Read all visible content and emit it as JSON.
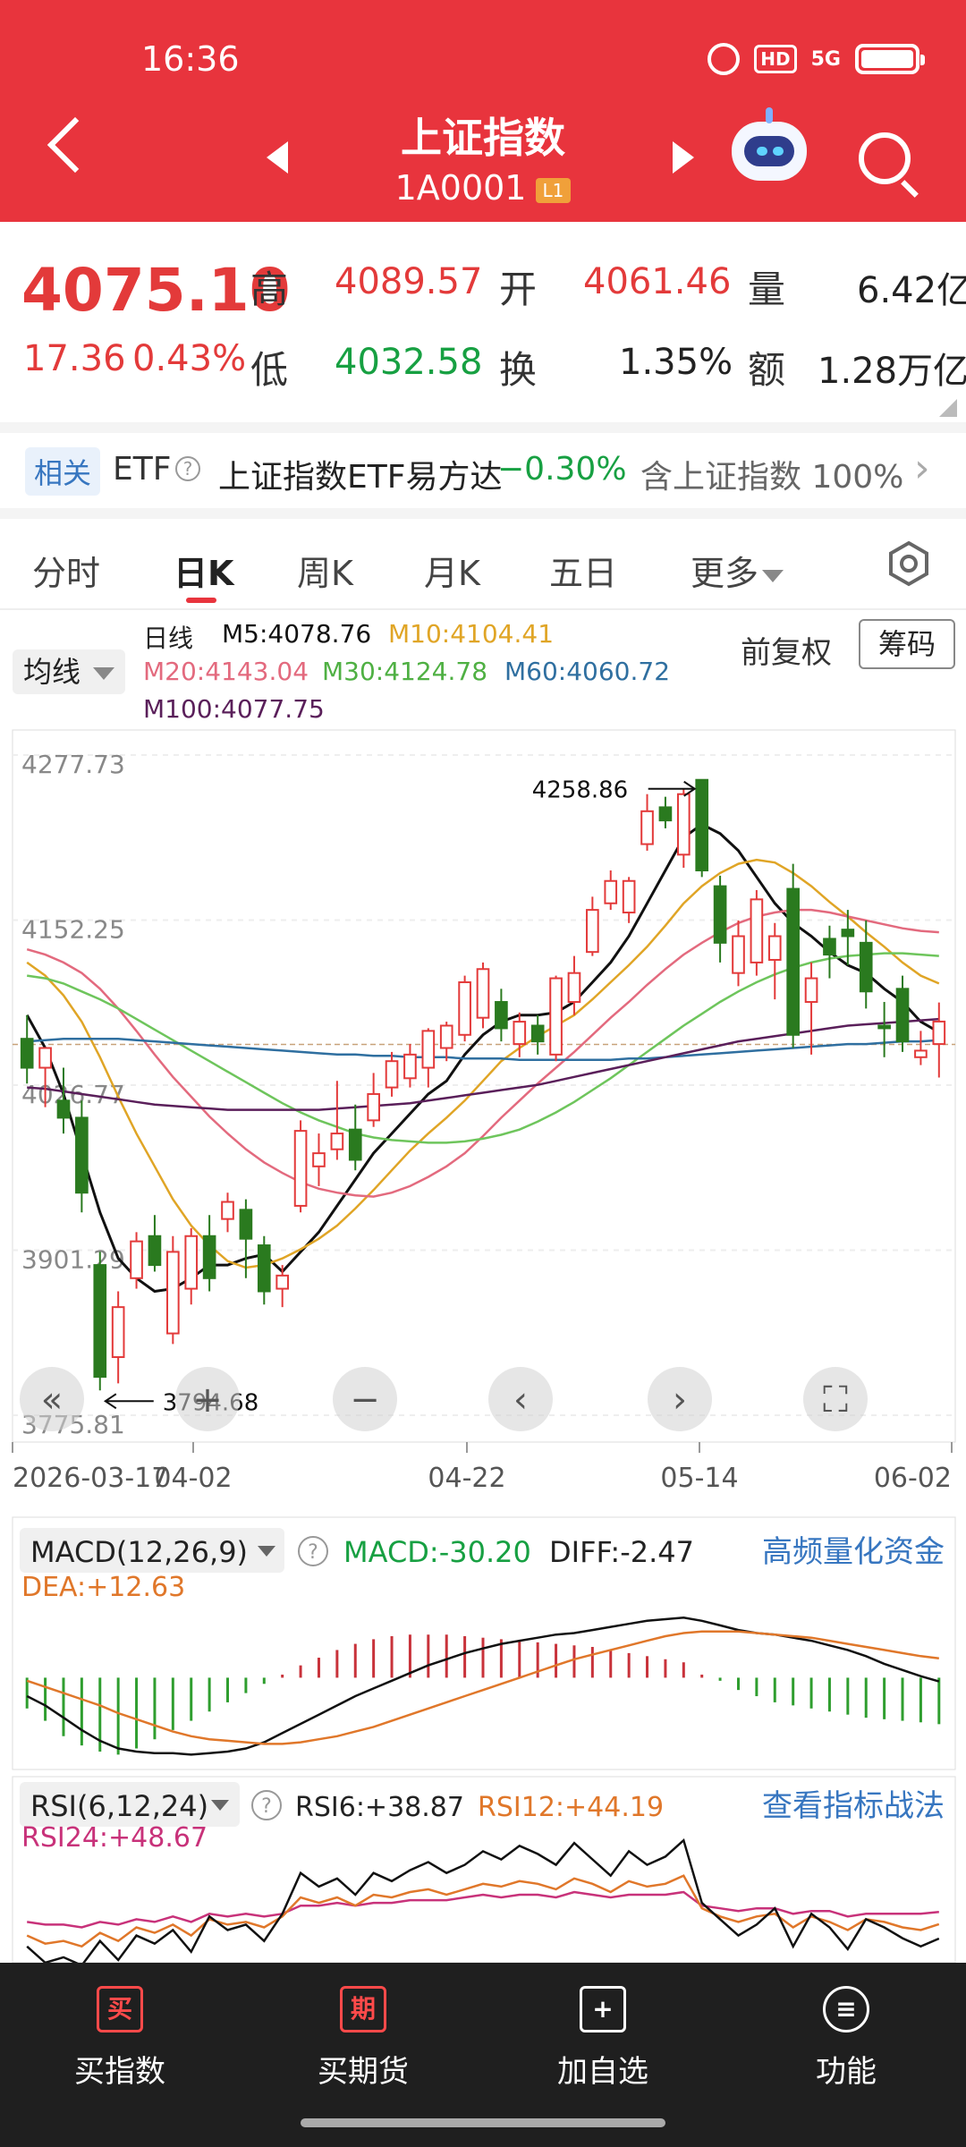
{
  "status": {
    "time": "16:36",
    "hd": "HD",
    "net": "5G"
  },
  "header": {
    "title": "上证指数",
    "code": "1A0001",
    "level": "L1"
  },
  "quote": {
    "price": "4075.10",
    "change": "17.36",
    "change_pct": "0.43%",
    "high_label": "高",
    "high": "4089.57",
    "open_label": "开",
    "open": "4061.46",
    "volume_label": "量",
    "volume": "6.42亿",
    "low_label": "低",
    "low": "4032.58",
    "turnover_label": "换",
    "turnover": "1.35%",
    "amount_label": "额",
    "amount": "1.28万亿"
  },
  "etf": {
    "tag": "相关",
    "prefix": "ETF",
    "help": "?",
    "name": "上证指数ETF易方达",
    "change": "−0.30%",
    "holding": "含上证指数 100%",
    "arrow": "›"
  },
  "tabs": [
    "分时",
    "日K",
    "周K",
    "月K",
    "五日",
    "更多"
  ],
  "ma": {
    "button": "均线",
    "period": "日线",
    "m5": "M5:4078.76",
    "m10": "M10:4104.41",
    "m20": "M20:4143.04",
    "m30": "M30:4124.78",
    "m60": "M60:4060.72",
    "m100": "M100:4077.75",
    "adjust": "前复权",
    "chip": "筹码"
  },
  "colors": {
    "up": "#e33a3a",
    "down": "#2a7a1f",
    "m5": "#111111",
    "m10": "#e0a526",
    "m20": "#e36a7e",
    "m30": "#6ec55c",
    "m60": "#2f6fa0",
    "m100": "#5a1f5a"
  },
  "chart_data": [
    {
      "type": "candlestick",
      "ylim": [
        3775.81,
        4277.73
      ],
      "y_ticks": [
        "4277.73",
        "4152.25",
        "4026.77",
        "3901.29",
        "3775.81"
      ],
      "x_ticks": [
        "2026-03-17",
        "04-02",
        "04-22",
        "05-14",
        "06-02"
      ],
      "max_label": "4258.86",
      "min_label": "3794.68",
      "reference_line": 4057.74,
      "candles": [
        {
          "o": 4062,
          "h": 4080,
          "l": 4028,
          "c": 4040
        },
        {
          "o": 4040,
          "h": 4055,
          "l": 4010,
          "c": 4055
        },
        {
          "o": 4015,
          "h": 4040,
          "l": 3990,
          "c": 4002
        },
        {
          "o": 4002,
          "h": 4015,
          "l": 3930,
          "c": 3945
        },
        {
          "o": 3890,
          "h": 3900,
          "l": 3794.68,
          "c": 3805
        },
        {
          "o": 3820,
          "h": 3870,
          "l": 3800,
          "c": 3858
        },
        {
          "o": 3880,
          "h": 3915,
          "l": 3872,
          "c": 3908
        },
        {
          "o": 3912,
          "h": 3928,
          "l": 3885,
          "c": 3890
        },
        {
          "o": 3838,
          "h": 3912,
          "l": 3830,
          "c": 3900
        },
        {
          "o": 3872,
          "h": 3918,
          "l": 3860,
          "c": 3912
        },
        {
          "o": 3912,
          "h": 3928,
          "l": 3870,
          "c": 3880
        },
        {
          "o": 3925,
          "h": 3945,
          "l": 3915,
          "c": 3938
        },
        {
          "o": 3932,
          "h": 3940,
          "l": 3880,
          "c": 3910
        },
        {
          "o": 3905,
          "h": 3912,
          "l": 3860,
          "c": 3870
        },
        {
          "o": 3872,
          "h": 3890,
          "l": 3858,
          "c": 3882
        },
        {
          "o": 3935,
          "h": 4000,
          "l": 3930,
          "c": 3992
        },
        {
          "o": 3965,
          "h": 3990,
          "l": 3950,
          "c": 3975
        },
        {
          "o": 3978,
          "h": 4030,
          "l": 3970,
          "c": 3990
        },
        {
          "o": 3993,
          "h": 4012,
          "l": 3962,
          "c": 3970
        },
        {
          "o": 4000,
          "h": 4036,
          "l": 3995,
          "c": 4020
        },
        {
          "o": 4025,
          "h": 4052,
          "l": 4018,
          "c": 4045
        },
        {
          "o": 4032,
          "h": 4058,
          "l": 4025,
          "c": 4050
        },
        {
          "o": 4040,
          "h": 4070,
          "l": 4025,
          "c": 4068
        },
        {
          "o": 4055,
          "h": 4075,
          "l": 4045,
          "c": 4072
        },
        {
          "o": 4065,
          "h": 4110,
          "l": 4060,
          "c": 4105
        },
        {
          "o": 4078,
          "h": 4120,
          "l": 4070,
          "c": 4115
        },
        {
          "o": 4090,
          "h": 4100,
          "l": 4060,
          "c": 4070
        },
        {
          "o": 4058,
          "h": 4082,
          "l": 4048,
          "c": 4075
        },
        {
          "o": 4072,
          "h": 4080,
          "l": 4050,
          "c": 4060
        },
        {
          "o": 4050,
          "h": 4110,
          "l": 4045,
          "c": 4108
        },
        {
          "o": 4090,
          "h": 4125,
          "l": 4080,
          "c": 4112
        },
        {
          "o": 4128,
          "h": 4170,
          "l": 4125,
          "c": 4160
        },
        {
          "o": 4165,
          "h": 4190,
          "l": 4160,
          "c": 4182
        },
        {
          "o": 4158,
          "h": 4185,
          "l": 4150,
          "c": 4182
        },
        {
          "o": 4210,
          "h": 4248,
          "l": 4205,
          "c": 4235
        },
        {
          "o": 4238,
          "h": 4246,
          "l": 4222,
          "c": 4228
        },
        {
          "o": 4202,
          "h": 4252,
          "l": 4192,
          "c": 4248
        },
        {
          "o": 4258.86,
          "h": 4258.86,
          "l": 4185,
          "c": 4190
        },
        {
          "o": 4178,
          "h": 4186,
          "l": 4120,
          "c": 4135
        },
        {
          "o": 4112,
          "h": 4152,
          "l": 4102,
          "c": 4140
        },
        {
          "o": 4120,
          "h": 4175,
          "l": 4110,
          "c": 4168
        },
        {
          "o": 4122,
          "h": 4150,
          "l": 4092,
          "c": 4140
        },
        {
          "o": 4176,
          "h": 4195,
          "l": 4055,
          "c": 4065
        },
        {
          "o": 4090,
          "h": 4120,
          "l": 4050,
          "c": 4108
        },
        {
          "o": 4138,
          "h": 4148,
          "l": 4108,
          "c": 4126
        },
        {
          "o": 4145,
          "h": 4160,
          "l": 4118,
          "c": 4140
        },
        {
          "o": 4135,
          "h": 4152,
          "l": 4085,
          "c": 4098
        },
        {
          "o": 4072,
          "h": 4090,
          "l": 4048,
          "c": 4070
        },
        {
          "o": 4100,
          "h": 4110,
          "l": 4052,
          "c": 4060
        },
        {
          "o": 4048,
          "h": 4068,
          "l": 4042,
          "c": 4053
        },
        {
          "o": 4058,
          "h": 4089.57,
          "l": 4032.58,
          "c": 4075.1
        }
      ],
      "ma_lines": [
        {
          "name": "M5",
          "values": [
            4080,
            4055,
            4020,
            3975,
            3930,
            3895,
            3880,
            3870,
            3872,
            3880,
            3890,
            3890,
            3895,
            3898,
            3885,
            3900,
            3915,
            3935,
            3955,
            3975,
            3990,
            4005,
            4020,
            4030,
            4050,
            4065,
            4075,
            4080,
            4080,
            4082,
            4090,
            4105,
            4120,
            4140,
            4165,
            4190,
            4215,
            4225,
            4218,
            4205,
            4185,
            4165,
            4150,
            4140,
            4128,
            4118,
            4112,
            4100,
            4090,
            4075,
            4067
          ]
        },
        {
          "name": "M10",
          "values": [
            4120,
            4110,
            4095,
            4075,
            4048,
            4018,
            3990,
            3965,
            3940,
            3920,
            3905,
            3893,
            3888,
            3890,
            3895,
            3902,
            3910,
            3920,
            3933,
            3947,
            3962,
            3977,
            3990,
            4002,
            4015,
            4030,
            4045,
            4055,
            4064,
            4072,
            4080,
            4092,
            4105,
            4118,
            4132,
            4148,
            4165,
            4178,
            4188,
            4195,
            4198,
            4196,
            4188,
            4178,
            4166,
            4155,
            4143,
            4132,
            4120,
            4110,
            4104
          ]
        },
        {
          "name": "M20",
          "values": [
            4130,
            4126,
            4120,
            4112,
            4100,
            4085,
            4068,
            4050,
            4033,
            4018,
            4003,
            3990,
            3978,
            3968,
            3960,
            3953,
            3948,
            3945,
            3943,
            3942,
            3945,
            3950,
            3957,
            3965,
            3975,
            3988,
            4002,
            4015,
            4028,
            4040,
            4052,
            4065,
            4078,
            4090,
            4103,
            4115,
            4126,
            4135,
            4143,
            4150,
            4155,
            4158,
            4160,
            4160,
            4158,
            4155,
            4152,
            4149,
            4146,
            4144,
            4143
          ]
        },
        {
          "name": "M30",
          "values": [
            4110,
            4108,
            4104,
            4098,
            4092,
            4085,
            4077,
            4069,
            4061,
            4053,
            4045,
            4037,
            4029,
            4021,
            4013,
            4006,
            4000,
            3995,
            3990,
            3987,
            3985,
            3984,
            3983,
            3983,
            3984,
            3986,
            3989,
            3993,
            3999,
            4006,
            4014,
            4023,
            4032,
            4042,
            4052,
            4062,
            4072,
            4081,
            4090,
            4098,
            4105,
            4111,
            4116,
            4120,
            4123,
            4125,
            4126,
            4127,
            4127,
            4126,
            4125
          ]
        },
        {
          "name": "M60",
          "values": [
            4060,
            4061,
            4062,
            4062,
            4062,
            4062,
            4061,
            4060,
            4059,
            4058,
            4057,
            4056,
            4055,
            4054,
            4053,
            4052,
            4051,
            4050,
            4050,
            4049,
            4049,
            4048,
            4048,
            4048,
            4047,
            4047,
            4047,
            4046,
            4046,
            4046,
            4046,
            4046,
            4046,
            4047,
            4047,
            4048,
            4049,
            4050,
            4051,
            4052,
            4053,
            4054,
            4055,
            4056,
            4057,
            4058,
            4058,
            4059,
            4060,
            4060,
            4061
          ]
        },
        {
          "name": "M100",
          "values": [
            4025,
            4024,
            4022,
            4020,
            4018,
            4016,
            4014,
            4012,
            4011,
            4010,
            4009,
            4008,
            4008,
            4008,
            4008,
            4008,
            4008,
            4009,
            4010,
            4011,
            4012,
            4013,
            4015,
            4017,
            4019,
            4021,
            4023,
            4025,
            4027,
            4030,
            4033,
            4036,
            4039,
            4042,
            4045,
            4048,
            4051,
            4054,
            4057,
            4060,
            4062,
            4064,
            4066,
            4068,
            4070,
            4072,
            4073,
            4074,
            4075,
            4076,
            4077
          ]
        }
      ]
    },
    {
      "type": "macd",
      "params": "MACD(12,26,9)",
      "macd_label": "MACD:-30.20",
      "diff_label": "DIFF:-2.47",
      "dea_label": "DEA:+12.63",
      "ylim": [
        -55,
        45
      ],
      "hist": [
        -20,
        -28,
        -38,
        -44,
        -48,
        -50,
        -46,
        -40,
        -34,
        -28,
        -22,
        -16,
        -10,
        -4,
        2,
        8,
        13,
        18,
        22,
        25,
        27,
        28,
        28,
        28,
        27,
        26,
        25,
        24,
        23,
        22,
        21,
        20,
        18,
        16,
        14,
        12,
        10,
        2,
        -2,
        -8,
        -12,
        -16,
        -18,
        -20,
        -22,
        -24,
        -26,
        -27,
        -28,
        -29,
        -30.2
      ],
      "diff": [
        -12,
        -18,
        -26,
        -34,
        -41,
        -46,
        -48,
        -49,
        -49,
        -50,
        -49,
        -48,
        -46,
        -42,
        -36,
        -30,
        -24,
        -18,
        -12,
        -7,
        -2,
        3,
        8,
        12,
        16,
        19,
        22,
        24,
        26,
        28,
        29,
        31,
        33,
        35,
        37,
        38,
        39,
        37,
        34,
        31,
        29,
        28,
        26,
        24,
        21,
        18,
        14,
        9,
        5,
        1,
        -2.47
      ],
      "dea": [
        -2,
        -6,
        -10,
        -14,
        -18,
        -23,
        -27,
        -31,
        -35,
        -38,
        -40,
        -41,
        -42,
        -43,
        -43,
        -42,
        -40,
        -38,
        -35,
        -32,
        -28,
        -24,
        -20,
        -16,
        -12,
        -8,
        -4,
        0,
        4,
        8,
        12,
        15,
        18,
        21,
        24,
        27,
        29,
        30,
        30,
        30,
        29,
        28,
        27,
        26,
        24,
        22,
        20,
        18,
        16,
        14,
        12.63
      ]
    },
    {
      "type": "rsi",
      "params": "RSI(6,12,24)",
      "rsi6_label": "RSI6:+38.87",
      "rsi12_label": "RSI12:+44.19",
      "rsi24_label": "RSI24:+48.67",
      "ylim": [
        30,
        80
      ],
      "rsi6": [
        36,
        30,
        32,
        29,
        38,
        31,
        40,
        37,
        42,
        34,
        47,
        42,
        44,
        38,
        48,
        63,
        58,
        61,
        55,
        63,
        60,
        64,
        67,
        63,
        66,
        71,
        68,
        73,
        70,
        66,
        74,
        68,
        62,
        71,
        66,
        69,
        75,
        52,
        46,
        40,
        44,
        50,
        36,
        48,
        43,
        35,
        46,
        43,
        39,
        36,
        38.87
      ],
      "rsi12": [
        40,
        37,
        38,
        36,
        41,
        38,
        43,
        41,
        44,
        40,
        46,
        44,
        45,
        43,
        47,
        54,
        52,
        54,
        51,
        55,
        54,
        56,
        57,
        55,
        57,
        59,
        58,
        60,
        59,
        57,
        61,
        59,
        56,
        60,
        58,
        59,
        62,
        50,
        47,
        45,
        47,
        48,
        43,
        47,
        45,
        42,
        46,
        45,
        43,
        42,
        44.19
      ],
      "rsi24": [
        45,
        44,
        44,
        43,
        45,
        44,
        46,
        45,
        47,
        45,
        48,
        47,
        48,
        47,
        48,
        51,
        51,
        52,
        51,
        52,
        52,
        53,
        53,
        53,
        54,
        55,
        54,
        55,
        55,
        54,
        56,
        55,
        54,
        55,
        55,
        55,
        56,
        51,
        50,
        49,
        50,
        50,
        48,
        49,
        49,
        47,
        48,
        48,
        48,
        48,
        48.67
      ]
    }
  ],
  "indicators": {
    "macd_link": "高频量化资金",
    "rsi_link": "查看指标战法",
    "help": "?"
  },
  "chart_controls": {
    "fast_back": "«",
    "zoom_in": "+",
    "zoom_out": "−",
    "prev": "‹",
    "next": "›",
    "fullscreen": "⛶"
  },
  "bottom_nav": [
    {
      "label": "买指数",
      "icon": "买"
    },
    {
      "label": "买期货",
      "icon": "期"
    },
    {
      "label": "加自选",
      "icon": "+"
    },
    {
      "label": "功能",
      "icon": "≡"
    }
  ]
}
